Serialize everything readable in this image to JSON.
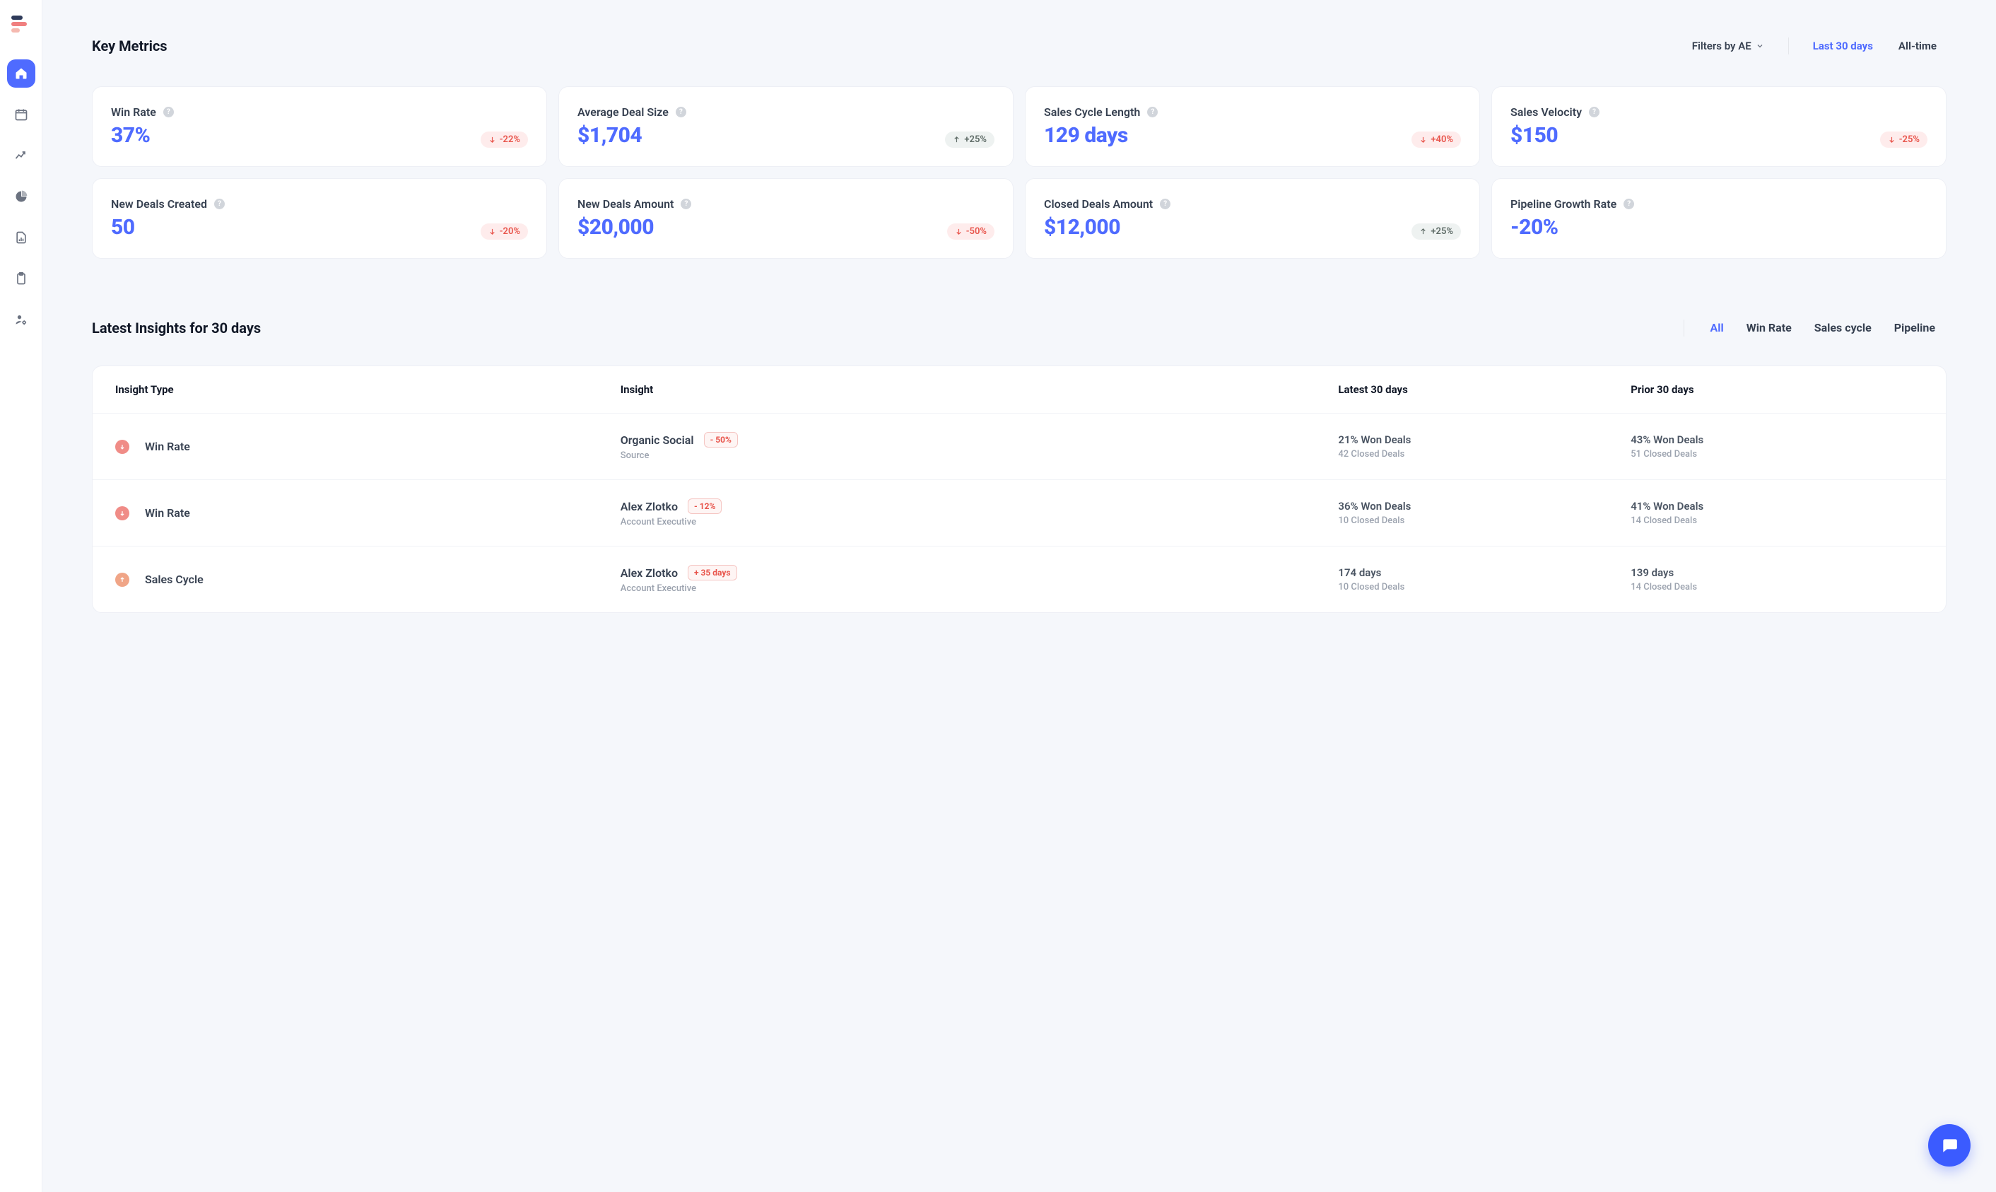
{
  "header": {
    "title": "Key Metrics",
    "filter_label": "Filters by AE",
    "time_options": {
      "last30": "Last 30 days",
      "alltime": "All-time"
    }
  },
  "metrics": [
    {
      "label": "Win Rate",
      "value": "37%",
      "delta": "-22%",
      "dir": "down"
    },
    {
      "label": "Average Deal Size",
      "value": "$1,704",
      "delta": "+25%",
      "dir": "up"
    },
    {
      "label": "Sales Cycle Length",
      "value": "129 days",
      "delta": "+40%",
      "dir": "down"
    },
    {
      "label": "Sales Velocity",
      "value": "$150",
      "delta": "-25%",
      "dir": "down"
    },
    {
      "label": "New Deals Created",
      "value": "50",
      "delta": "-20%",
      "dir": "down"
    },
    {
      "label": "New Deals Amount",
      "value": "$20,000",
      "delta": "-50%",
      "dir": "down"
    },
    {
      "label": "Closed Deals Amount",
      "value": "$12,000",
      "delta": "+25%",
      "dir": "up"
    },
    {
      "label": "Pipeline Growth Rate",
      "value": "-20%",
      "delta": null,
      "dir": null
    }
  ],
  "insights": {
    "title": "Latest Insights for 30 days",
    "tabs": {
      "all": "All",
      "winrate": "Win Rate",
      "salescycle": "Sales cycle",
      "pipeline": "Pipeline"
    },
    "columns": {
      "type": "Insight Type",
      "insight": "Insight",
      "latest": "Latest 30 days",
      "prior": "Prior 30 days"
    },
    "rows": [
      {
        "dir": "down",
        "type_label": "Win Rate",
        "insight_title": "Organic Social",
        "pill": "- 50%",
        "pill_kind": "neg",
        "insight_sub": "Source",
        "latest_primary": "21% Won Deals",
        "latest_secondary": "42 Closed Deals",
        "prior_primary": "43% Won Deals",
        "prior_secondary": "51 Closed Deals"
      },
      {
        "dir": "down",
        "type_label": "Win Rate",
        "insight_title": "Alex Zlotko",
        "pill": "- 12%",
        "pill_kind": "neg",
        "insight_sub": "Account Executive",
        "latest_primary": "36% Won Deals",
        "latest_secondary": "10 Closed Deals",
        "prior_primary": "41% Won Deals",
        "prior_secondary": "14 Closed Deals"
      },
      {
        "dir": "up",
        "type_label": "Sales Cycle",
        "insight_title": "Alex Zlotko",
        "pill": "+ 35 days",
        "pill_kind": "pos",
        "insight_sub": "Account Executive",
        "latest_primary": "174 days",
        "latest_secondary": "10 Closed Deals",
        "prior_primary": "139 days",
        "prior_secondary": "14 Closed Deals"
      }
    ]
  }
}
